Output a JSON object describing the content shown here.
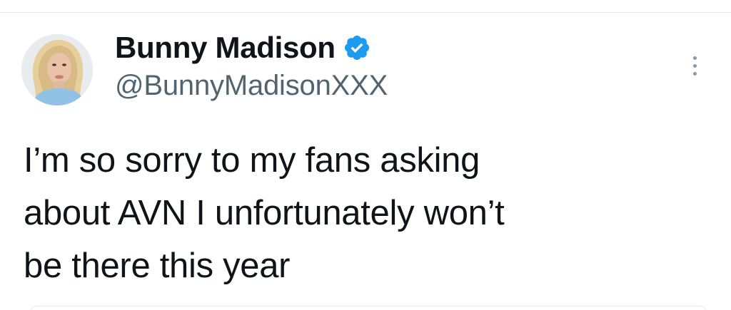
{
  "tweet": {
    "author": {
      "display_name": "Bunny Madison",
      "handle": "@BunnyMadisonXXX",
      "verified": true,
      "avatar_icon": "profile-photo",
      "verified_icon": "verified-badge-icon"
    },
    "text": "I’m so sorry to my fans asking\nabout AVN I unfortunately won’t\nbe there this year",
    "more_icon": "more-vertical-icon"
  },
  "colors": {
    "text": "#0f1419",
    "secondary_text": "#536471",
    "verified_blue": "#1d9bf0",
    "divider": "#e6e9ec"
  }
}
